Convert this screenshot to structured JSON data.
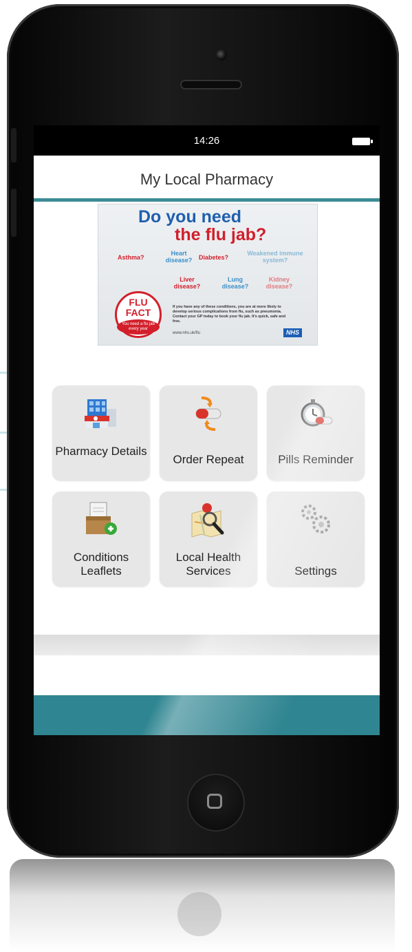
{
  "status_bar": {
    "time": "14:26"
  },
  "nav": {
    "title": "My Local Pharmacy"
  },
  "banner": {
    "headline_1": "Do you need",
    "headline_2": "the flu jab?",
    "conditions": [
      "Asthma?",
      "Heart disease?",
      "Diabetes?",
      "Weakened immune system?",
      "Liver disease?",
      "Lung disease?",
      "Kidney disease?"
    ],
    "badge_title": "FLU FACT",
    "badge_sub": "You need a flu jab every year",
    "body": "If you have any of these conditions, you are at more likely to develop serious complications from flu, such as pneumonia. Contact your GP today to book your flu jab. It's quick, safe and free.",
    "url": "www.nhs.uk/flu",
    "logo": "NHS"
  },
  "tiles": [
    {
      "label": "Pharmacy Details",
      "icon": "pharmacy-building-icon"
    },
    {
      "label": "Order Repeat",
      "icon": "pill-refresh-icon"
    },
    {
      "label": "Pills Reminder",
      "icon": "stopwatch-pill-icon"
    },
    {
      "label": "Conditions Leaflets",
      "icon": "leaflet-box-icon"
    },
    {
      "label": "Local Health Services",
      "icon": "map-magnifier-icon"
    },
    {
      "label": "Settings",
      "icon": "gears-icon"
    }
  ],
  "colors": {
    "accent": "#2f8591",
    "tile_bg": "#e7e7e8",
    "banner_blue": "#1f5fae",
    "banner_red": "#d21f2b"
  }
}
